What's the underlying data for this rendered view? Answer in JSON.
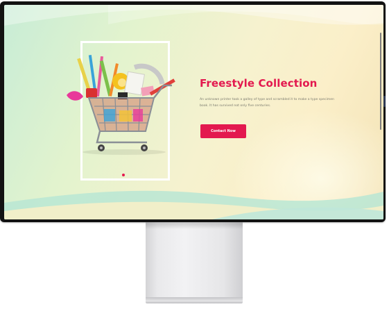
{
  "hero": {
    "title": "Freestyle Collection",
    "description": "An unknown printer took a galley of type and scrambled it to make a type specimen book. It has survived not only five centuries.",
    "cta_label": "Contact Now"
  },
  "colors": {
    "accent": "#e3194f",
    "frame": "#ffffff",
    "bezel": "#121212",
    "stand": "#e9e9eb"
  },
  "icons": {
    "hero_image": "shopping-cart-with-stationery",
    "slider_indicator": "dot"
  }
}
